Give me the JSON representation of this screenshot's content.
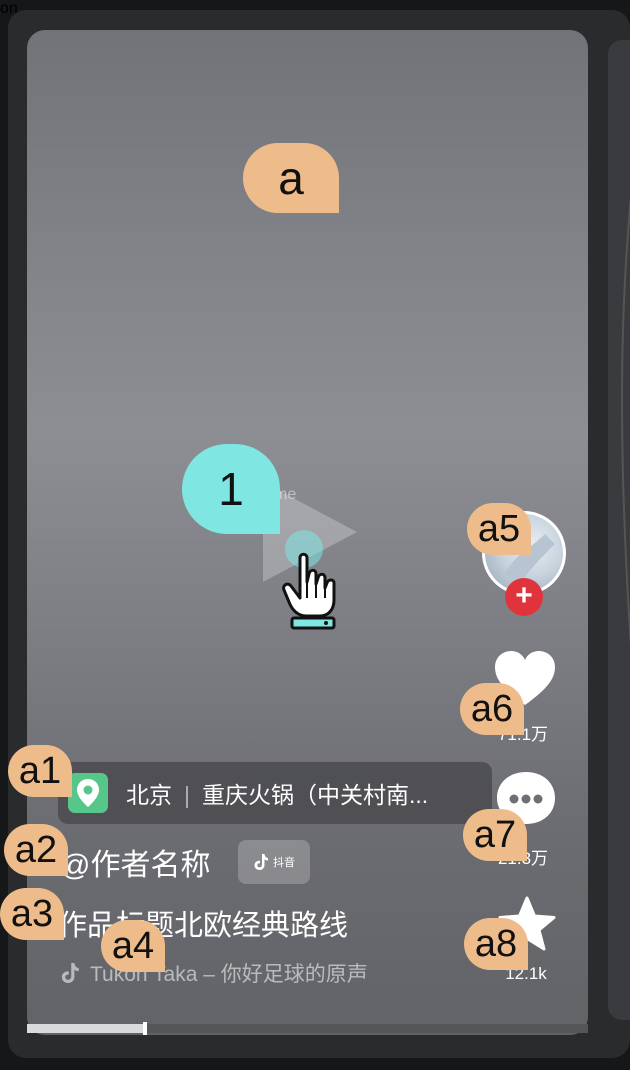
{
  "side_text": "on",
  "play": {
    "frame_label": "Frame"
  },
  "rail": {
    "like_count": "71.1万",
    "comment_count": "21.3万",
    "favorite_count": "12.1k"
  },
  "location": {
    "city": "北京",
    "place": "重庆火锅（中关村南..."
  },
  "author": {
    "handle": "@作者名称",
    "badge": "抖音"
  },
  "caption": "作品标题北欧经典路线",
  "music": "Tukon Taka – 你好足球的原声",
  "progress": 0.21,
  "annotations": {
    "a": "a",
    "a1": "a1",
    "a2": "a2",
    "a3": "a3",
    "a4": "a4",
    "a5": "a5",
    "a6": "a6",
    "a7": "a7",
    "a8": "a8",
    "step": "1"
  },
  "colors": {
    "annotation": "#eebc8a",
    "step_marker": "#7fe6e1",
    "follow": "#e0343c",
    "location_icon": "#56c68a"
  }
}
